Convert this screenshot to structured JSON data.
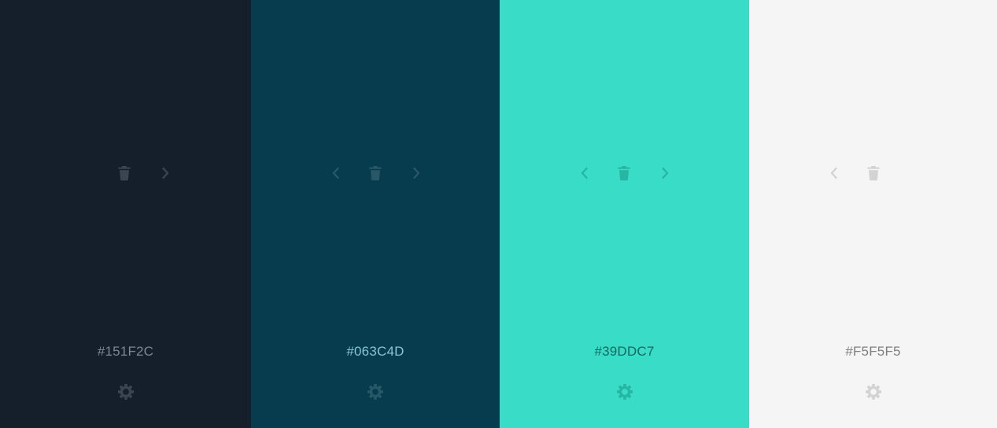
{
  "palette": {
    "swatches": [
      {
        "hex_label": "#151F2C",
        "color": "#151F2C",
        "controls": [
          "trash-icon",
          "chevron-right-icon"
        ],
        "settings_icon": "gear-icon"
      },
      {
        "hex_label": "#063C4D",
        "color": "#063C4D",
        "controls": [
          "chevron-left-icon",
          "trash-icon",
          "chevron-right-icon"
        ],
        "settings_icon": "gear-icon"
      },
      {
        "hex_label": "#39DDC7",
        "color": "#39DDC7",
        "controls": [
          "chevron-left-icon",
          "trash-icon",
          "chevron-right-icon"
        ],
        "settings_icon": "gear-icon"
      },
      {
        "hex_label": "#F5F5F5",
        "color": "#F5F5F5",
        "controls": [
          "chevron-left-icon",
          "trash-icon"
        ],
        "settings_icon": "gear-icon"
      }
    ]
  }
}
